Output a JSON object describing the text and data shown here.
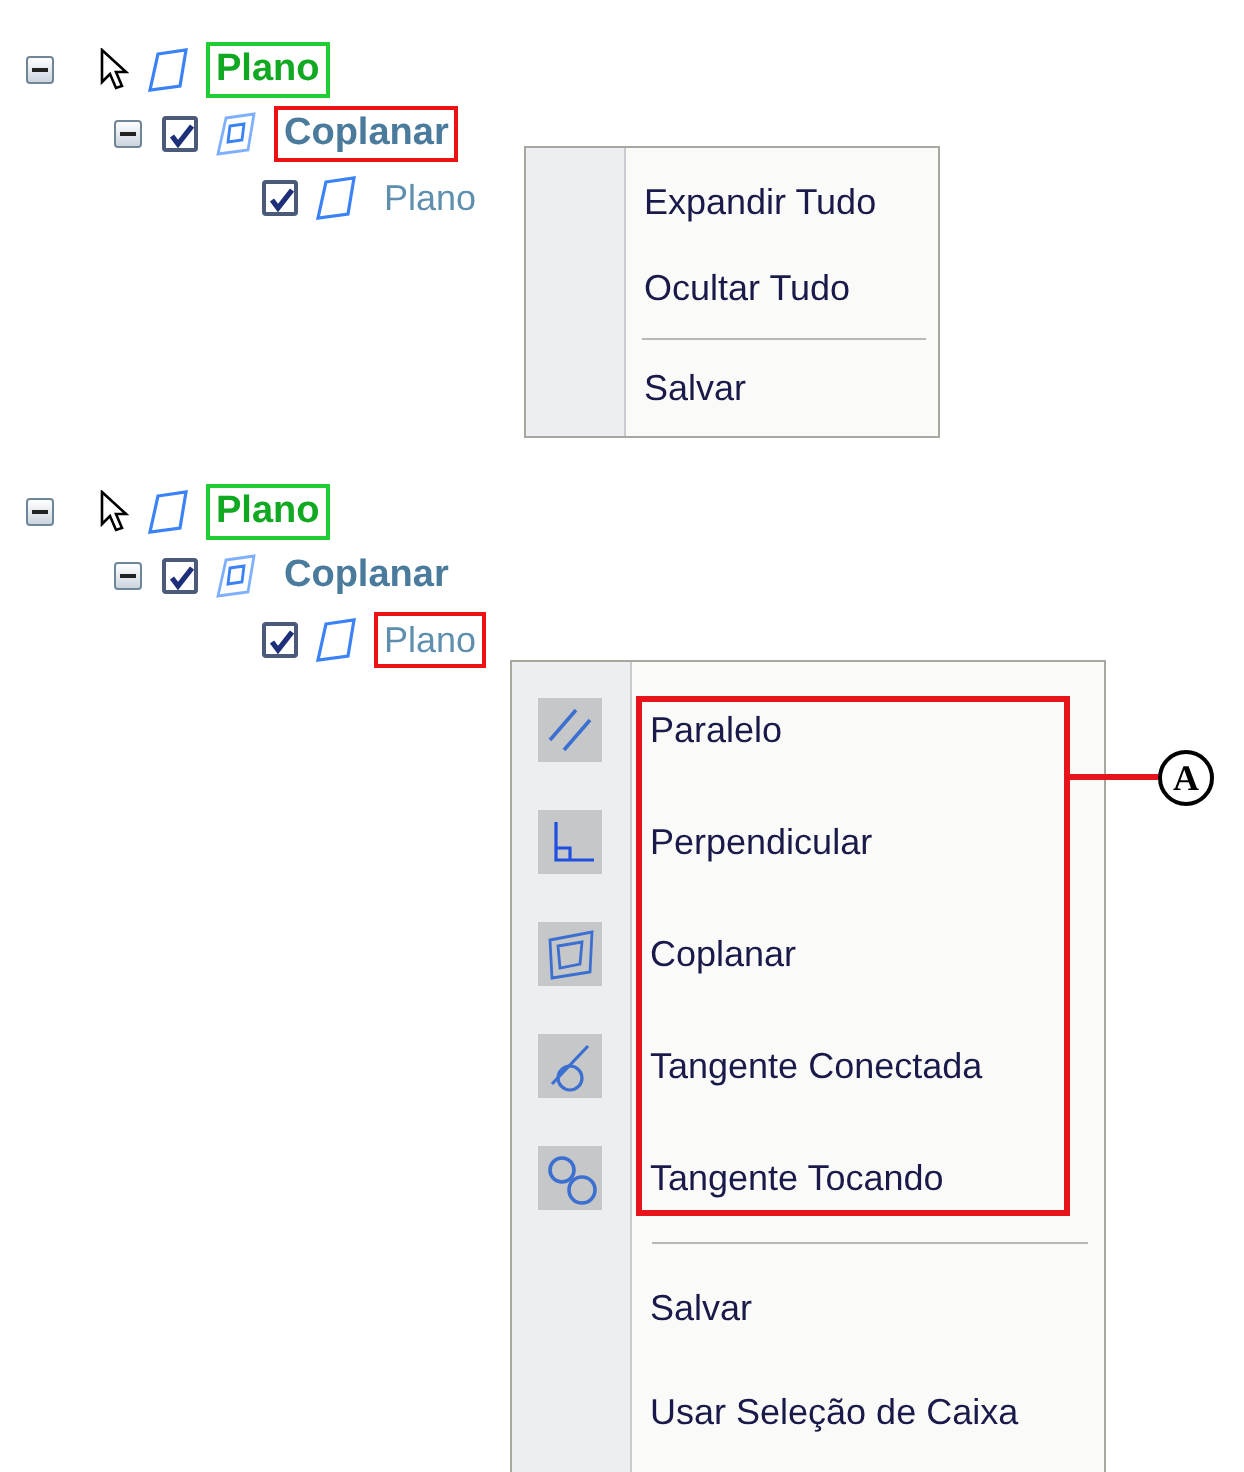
{
  "panels": [
    {
      "tree": [
        {
          "kind": "root",
          "label": "Plano",
          "expanded": true,
          "color": "#22cc33",
          "children": [
            {
              "kind": "group",
              "label": "Coplanar",
              "checked": true,
              "expanded": true,
              "color": "#ee1111",
              "children": [
                {
                  "kind": "leaf",
                  "label": "Plano",
                  "checked": true
                }
              ]
            }
          ]
        }
      ],
      "menu": {
        "items": [
          {
            "kind": "item",
            "label": "Expandir Tudo"
          },
          {
            "kind": "item",
            "label": "Ocultar Tudo"
          },
          {
            "kind": "separator"
          },
          {
            "kind": "item",
            "label": "Salvar"
          }
        ]
      }
    },
    {
      "tree": [
        {
          "kind": "root",
          "label": "Plano",
          "expanded": true,
          "color": "#22cc33",
          "children": [
            {
              "kind": "group",
              "label": "Coplanar",
              "checked": true,
              "expanded": true,
              "children": [
                {
                  "kind": "leaf",
                  "label": "Plano",
                  "checked": true,
                  "color": "#ee1111"
                }
              ]
            }
          ]
        }
      ],
      "menu": {
        "callout": "A",
        "items": [
          {
            "kind": "parallel",
            "label": "Paralelo"
          },
          {
            "kind": "perpendicular",
            "label": "Perpendicular"
          },
          {
            "kind": "coplanar",
            "label": "Coplanar"
          },
          {
            "kind": "tangent-connected",
            "label": "Tangente Conectada"
          },
          {
            "kind": "tangent-touching",
            "label": "Tangente Tocando"
          },
          {
            "kind": "separator"
          },
          {
            "kind": "item",
            "label": "Salvar"
          },
          {
            "kind": "item",
            "label": "Usar Seleção de Caixa"
          }
        ]
      }
    }
  ]
}
